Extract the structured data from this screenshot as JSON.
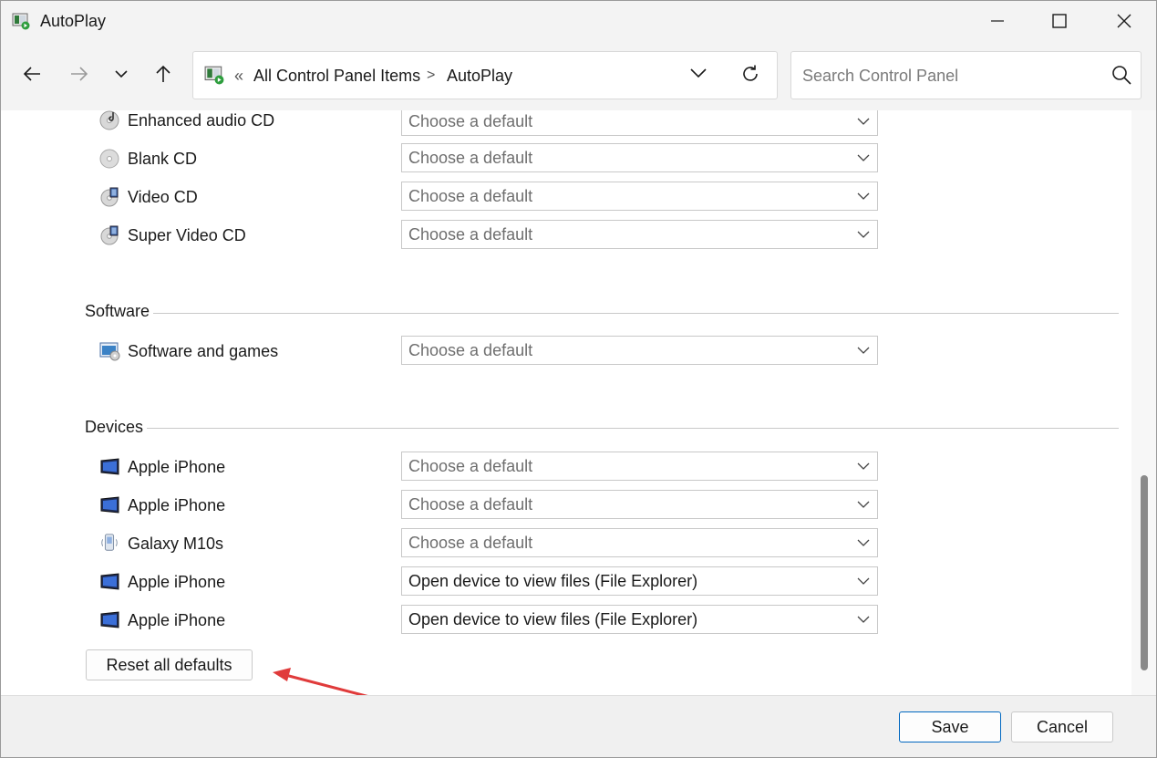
{
  "window": {
    "title": "AutoPlay",
    "controls": [
      "minimize",
      "maximize",
      "close"
    ]
  },
  "navigation": {
    "back_icon": "arrow-left-icon",
    "forward_icon": "arrow-right-icon",
    "recent_icon": "chevron-down-icon",
    "up_icon": "arrow-up-icon",
    "breadcrumb_prefix": "«",
    "breadcrumb": [
      "All Control Panel Items",
      "AutoPlay"
    ],
    "breadcrumb_separator": ">",
    "search_placeholder": "Search Control Panel"
  },
  "media_rows": [
    {
      "label": "Enhanced audio CD",
      "icon": "audio-cd-icon",
      "value": "Choose a default"
    },
    {
      "label": "Blank CD",
      "icon": "blank-cd-icon",
      "value": "Choose a default"
    },
    {
      "label": "Video CD",
      "icon": "video-cd-icon",
      "value": "Choose a default"
    },
    {
      "label": "Super Video CD",
      "icon": "super-video-cd-icon",
      "value": "Choose a default"
    }
  ],
  "software": {
    "heading": "Software",
    "rows": [
      {
        "label": "Software and games",
        "icon": "software-icon",
        "value": "Choose a default"
      }
    ]
  },
  "devices": {
    "heading": "Devices",
    "rows": [
      {
        "label": "Apple iPhone",
        "icon": "device-icon",
        "value": "Choose a default"
      },
      {
        "label": "Apple iPhone",
        "icon": "device-icon",
        "value": "Choose a default"
      },
      {
        "label": "Galaxy M10s",
        "icon": "phone-icon",
        "value": "Choose a default"
      },
      {
        "label": "Apple iPhone",
        "icon": "device-icon",
        "value": "Open device to view files (File Explorer)"
      },
      {
        "label": "Apple iPhone",
        "icon": "device-icon",
        "value": "Open device to view files (File Explorer)"
      }
    ]
  },
  "reset_button": "Reset all defaults",
  "footer": {
    "save": "Save",
    "cancel": "Cancel"
  },
  "colors": {
    "accent": "#0067c0",
    "annotation_arrow": "#e03b3b"
  }
}
